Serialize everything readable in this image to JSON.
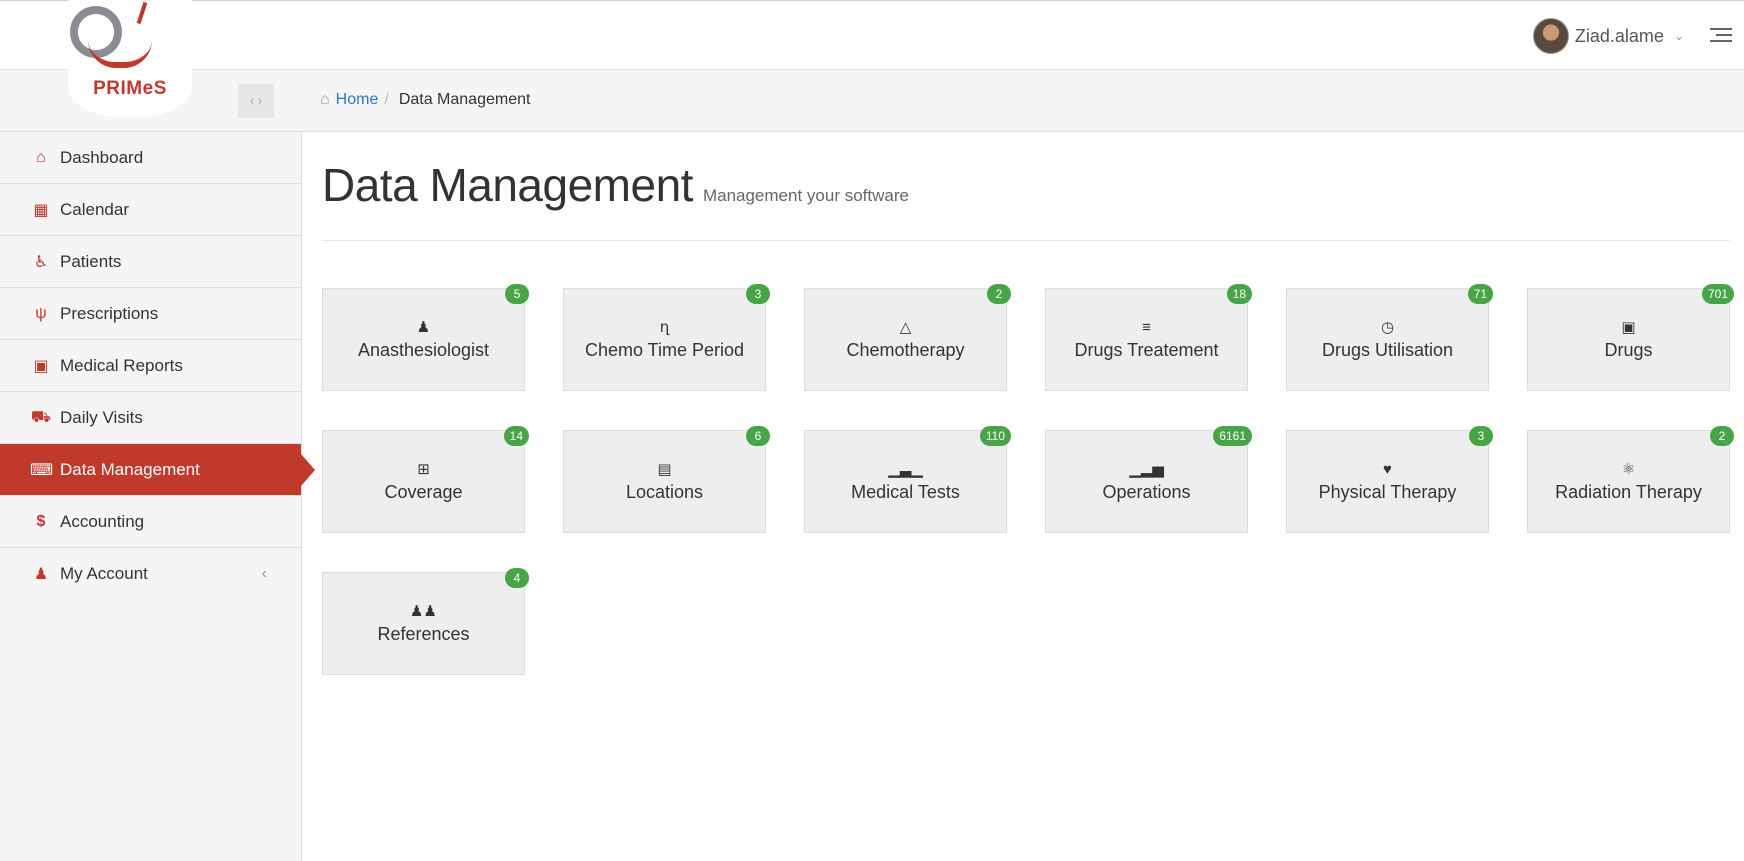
{
  "brand": {
    "logo_text": "PRIMeS"
  },
  "header": {
    "username": "Ziad.alame"
  },
  "breadcrumb": {
    "home": "Home",
    "separator": "/",
    "current": "Data Management"
  },
  "sidebar": {
    "items": [
      {
        "label": "Dashboard",
        "icon": "home-icon"
      },
      {
        "label": "Calendar",
        "icon": "calendar-icon"
      },
      {
        "label": "Patients",
        "icon": "wheelchair-icon"
      },
      {
        "label": "Prescriptions",
        "icon": "stethoscope-icon"
      },
      {
        "label": "Medical Reports",
        "icon": "hospital-icon"
      },
      {
        "label": "Daily Visits",
        "icon": "ambulance-icon"
      },
      {
        "label": "Data Management",
        "icon": "keyboard-icon",
        "active": true
      },
      {
        "label": "Accounting",
        "icon": "dollar-icon"
      },
      {
        "label": "My Account",
        "icon": "user-icon",
        "has_submenu": true
      }
    ]
  },
  "page": {
    "title": "Data Management",
    "subtitle": "Management your software"
  },
  "tiles": [
    {
      "label": "Anasthesiologist",
      "count": "5",
      "icon": "user-md-icon"
    },
    {
      "label": "Chemo Time Period",
      "count": "3",
      "icon": "time-period-icon"
    },
    {
      "label": "Chemotherapy",
      "count": "2",
      "icon": "flask-icon"
    },
    {
      "label": "Drugs Treatement",
      "count": "18",
      "icon": "list-icon"
    },
    {
      "label": "Drugs Utilisation",
      "count": "71",
      "icon": "clock-icon"
    },
    {
      "label": "Drugs",
      "count": "701",
      "icon": "medkit-icon"
    },
    {
      "label": "Coverage",
      "count": "14",
      "icon": "plus-square-icon"
    },
    {
      "label": "Locations",
      "count": "6",
      "icon": "building-icon"
    },
    {
      "label": "Medical Tests",
      "count": "110",
      "icon": "bar-chart-icon"
    },
    {
      "label": "Operations",
      "count": "6161",
      "icon": "signal-icon"
    },
    {
      "label": "Physical Therapy",
      "count": "3",
      "icon": "heart-icon"
    },
    {
      "label": "Radiation Therapy",
      "count": "2",
      "icon": "atom-icon"
    },
    {
      "label": "References",
      "count": "4",
      "icon": "users-icon"
    }
  ]
}
